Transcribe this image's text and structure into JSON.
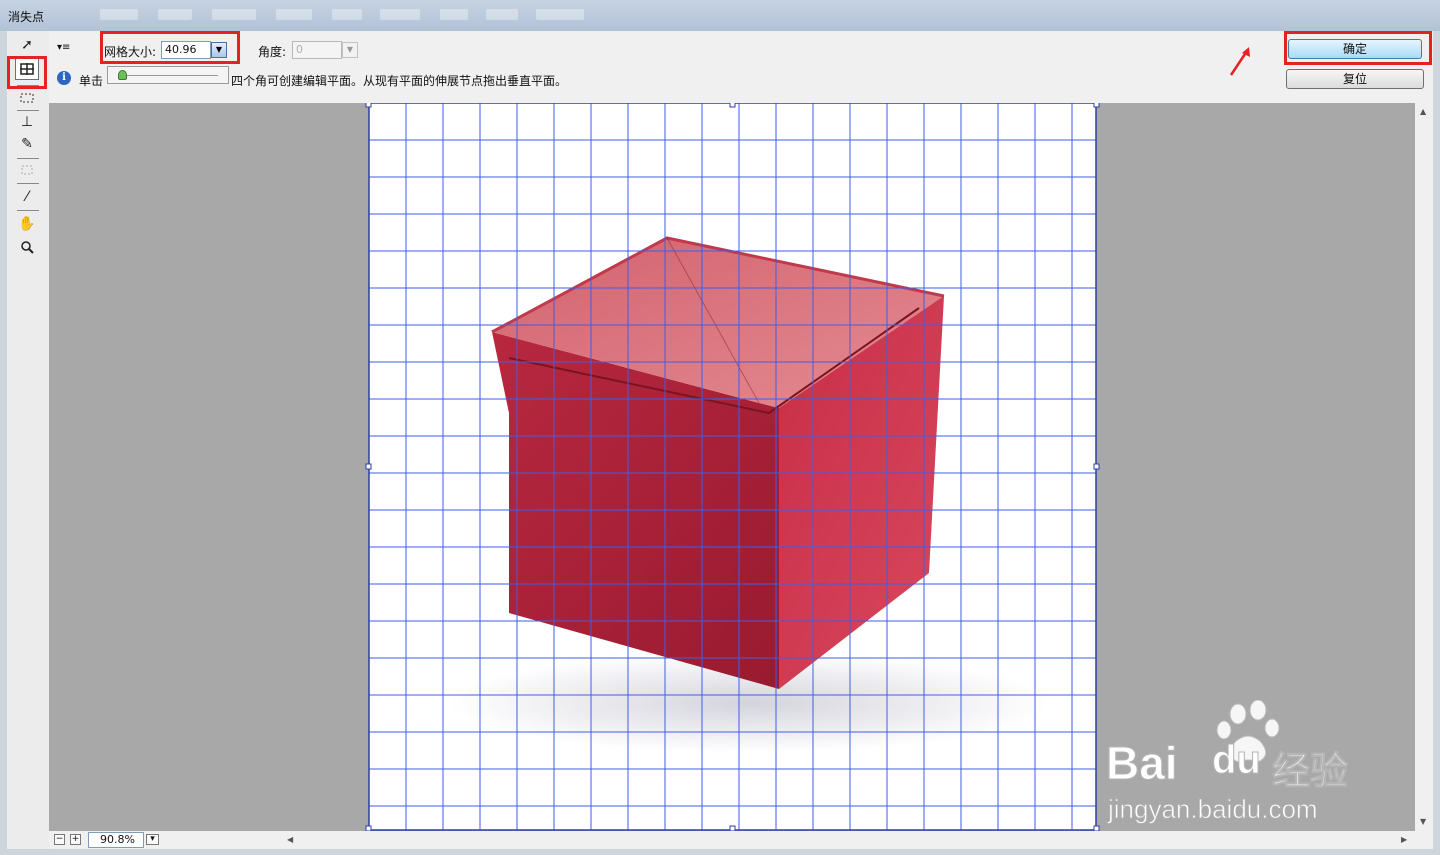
{
  "window": {
    "title": "消失点"
  },
  "options": {
    "grid_size_label": "网格大小:",
    "grid_size_value": "40.96",
    "angle_label": "角度:",
    "angle_value": "0"
  },
  "buttons": {
    "ok_label": "确定",
    "reset_label": "复位"
  },
  "info": {
    "prefix": "单击",
    "text": "四个角可创建编辑平面。从现有平面的伸展节点拖出垂直平面。"
  },
  "zoom": {
    "value": "90.8%"
  },
  "watermark": {
    "brand": "Bai",
    "brand_cn": "经验",
    "url": "jingyan.baidu.com"
  },
  "colors": {
    "highlight": "#e52222",
    "grid": "#3f5ee8",
    "cube": "#b8283f"
  }
}
